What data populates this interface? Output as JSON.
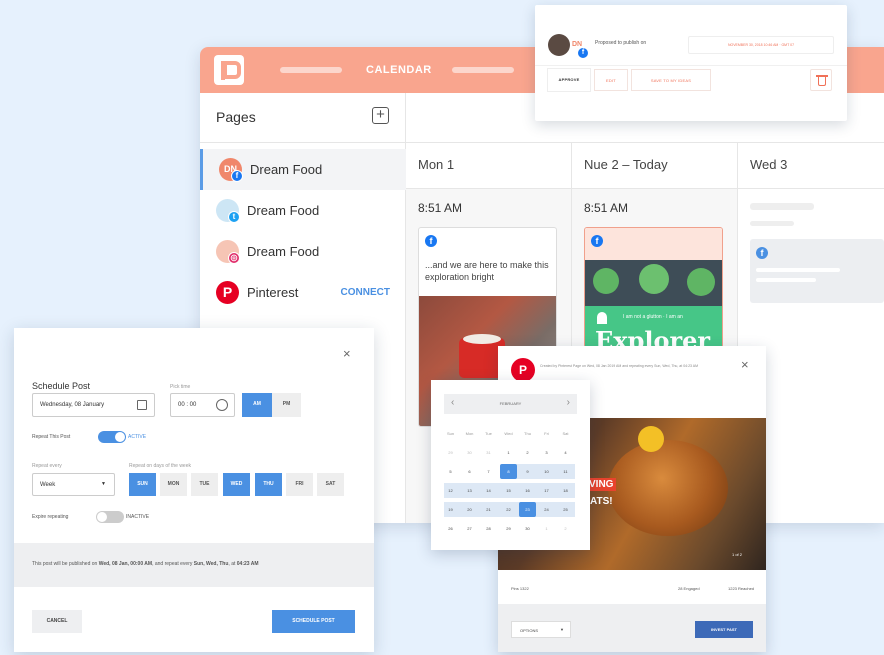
{
  "app": {
    "calendar_title": "CALENDAR",
    "pages_heading": "Pages",
    "add_icon": "+",
    "pages": [
      {
        "name": "Dream Food",
        "avatar": "DN",
        "network": "facebook"
      },
      {
        "name": "Dream Food",
        "network": "twitter"
      },
      {
        "name": "Dream Food",
        "network": "instagram"
      },
      {
        "name": "Pinterest",
        "network": "pinterest",
        "action": "CONNECT"
      }
    ],
    "columns": [
      {
        "day": "Mon 1",
        "time": "8:51 AM",
        "post_text": "...and we are here to make this exploration bright"
      },
      {
        "day": "Nue 2 – Today",
        "time": "8:51 AM",
        "post_big": "Explorer",
        "post_small": "I am not a glutton · I am an"
      },
      {
        "day": "Wed 3"
      }
    ],
    "colors": {
      "accent": "#f9a58e",
      "primary": "#4a90e2"
    }
  },
  "approval": {
    "avatar_initials": "DN",
    "text": "Proposed to publish on",
    "date": "NOVEMBER 30, 2018 10:46 AM · GMT 07",
    "approve": "APPROVE",
    "edit": "EDIT",
    "save_ideas": "SAVE TO MY IDEAS"
  },
  "schedule": {
    "title": "Schedule Post",
    "pick_time_label": "Pick time",
    "date_value": "Wednesday, 08 January",
    "time_value": "00 : 00",
    "am": "AM",
    "pm": "PM",
    "repeat_label": "Repeat This Post",
    "repeat_state": "ACTIVE",
    "repeat_every_label": "Repeat every",
    "repeat_every_value": "Week",
    "repeat_days_label": "Repeat on days of the week",
    "days": [
      {
        "d": "SUN",
        "on": true
      },
      {
        "d": "MON",
        "on": false
      },
      {
        "d": "TUE",
        "on": false
      },
      {
        "d": "WED",
        "on": true
      },
      {
        "d": "THU",
        "on": true
      },
      {
        "d": "FRI",
        "on": false
      },
      {
        "d": "SAT",
        "on": false
      }
    ],
    "expire_label": "Expire repeating",
    "expire_state": "INACTIVE",
    "summary_pre": "This post will be published on ",
    "summary_date": "Wed, 08 Jan, 00:00 AM",
    "summary_mid": ", and repeat every ",
    "summary_days": "Sun, Wed, Thu",
    "summary_post": ", at ",
    "summary_time": "04:23 AM",
    "cancel": "CANCEL",
    "submit": "SCHEDULE POST"
  },
  "datepicker": {
    "month": "FEBRUARY",
    "weekdays": [
      "Sun",
      "Mon",
      "Tue",
      "Wed",
      "Thu",
      "Fri",
      "Sat"
    ],
    "weeks": [
      [
        "29",
        "30",
        "31",
        "1",
        "2",
        "3",
        "4"
      ],
      [
        "5",
        "6",
        "7",
        "8",
        "9",
        "10",
        "11"
      ],
      [
        "12",
        "13",
        "14",
        "15",
        "16",
        "17",
        "18"
      ],
      [
        "19",
        "20",
        "21",
        "22",
        "23",
        "24",
        "25"
      ],
      [
        "26",
        "27",
        "28",
        "29",
        "30",
        "1",
        "2"
      ]
    ]
  },
  "preview": {
    "header_text": "Created by Pinterest Page on Wed, 08 Jan 2019 AM and repeating every Sun, Wed, Thu, at 04:23 AM",
    "overlay_1": "VING",
    "overlay_2": "ATS!",
    "page_num": "1 of 2",
    "pins": "Pins 1322",
    "engaged": "28 Engaged",
    "reached": "1223 Reached",
    "options": "OPTIONS",
    "action": "INVEST PAST"
  }
}
